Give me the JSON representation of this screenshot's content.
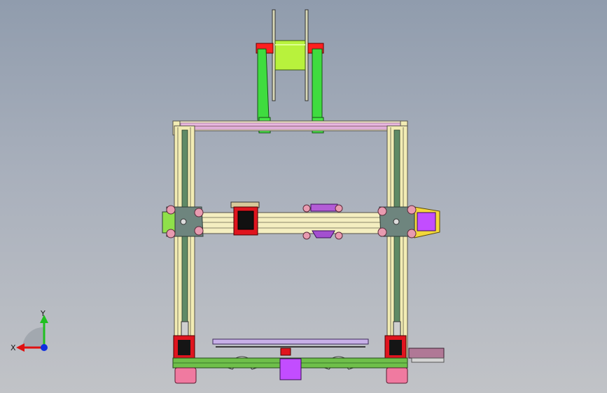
{
  "viewport": {
    "background_top": "#909cad",
    "background_bottom": "#c1c3c7"
  },
  "model": {
    "colors": {
      "frame_extrusion": "#f2ecb4",
      "frame_outline": "#55524a",
      "top_rail": "#e9b8e0",
      "spool": "#b8f23c",
      "spool_holder": "#3fdc3f",
      "spool_cap": "#ff1f1f",
      "carriage_plate": "#6e857e",
      "stepper_red": "#e0141e",
      "stepper_purple": "#c24dff",
      "yellow_plate": "#f3d83a",
      "foot": "#f07aa0",
      "base": "#6fbf4a",
      "wheel": "#e89bb0"
    }
  },
  "triad": {
    "x_label": "X",
    "y_label": "Y",
    "x_color": "#e01010",
    "y_color": "#20c020",
    "z_color": "#1030e0"
  }
}
